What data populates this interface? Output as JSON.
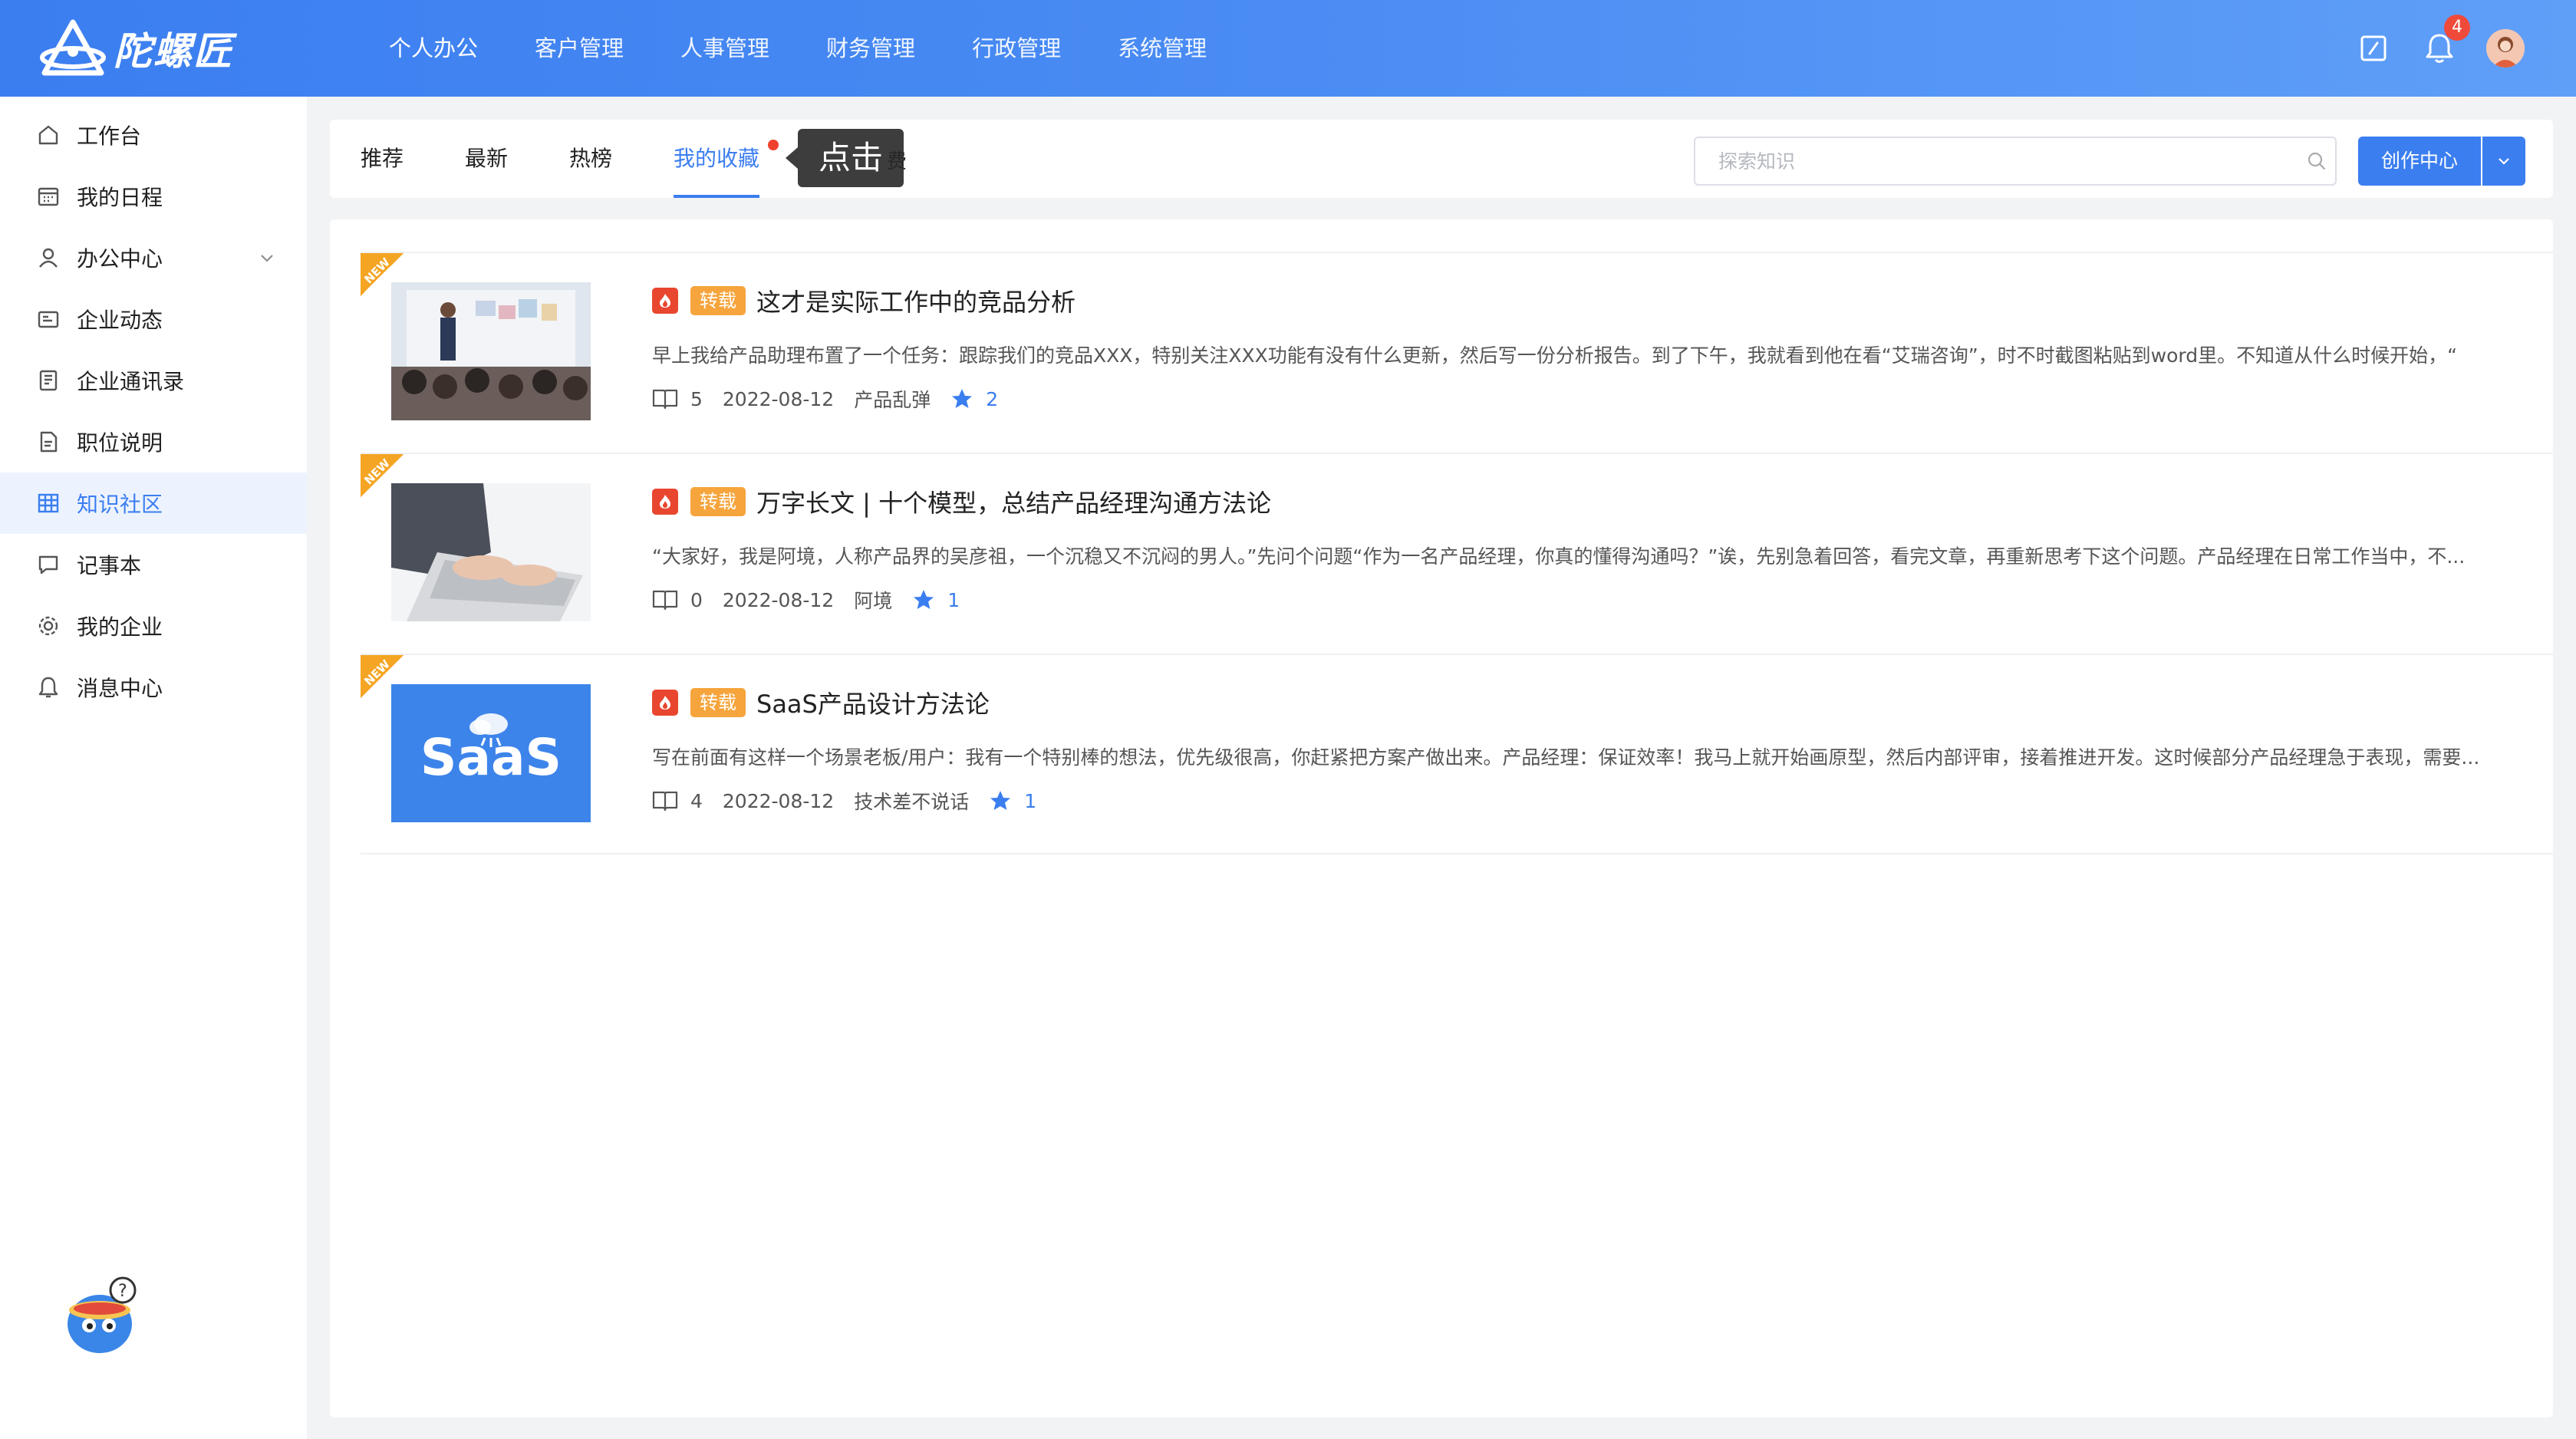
{
  "brand": {
    "name": "陀螺匠"
  },
  "topnav": [
    {
      "label": "个人办公",
      "active": true
    },
    {
      "label": "客户管理"
    },
    {
      "label": "人事管理"
    },
    {
      "label": "财务管理"
    },
    {
      "label": "行政管理"
    },
    {
      "label": "系统管理"
    }
  ],
  "header": {
    "notification_count": "4"
  },
  "sidebar": {
    "items": [
      {
        "label": "工作台",
        "icon": "home-icon"
      },
      {
        "label": "我的日程",
        "icon": "calendar-icon"
      },
      {
        "label": "办公中心",
        "icon": "user-icon",
        "expandable": true
      },
      {
        "label": "企业动态",
        "icon": "news-icon"
      },
      {
        "label": "企业通讯录",
        "icon": "contacts-icon"
      },
      {
        "label": "职位说明",
        "icon": "document-icon"
      },
      {
        "label": "知识社区",
        "icon": "grid-icon",
        "active": true
      },
      {
        "label": "记事本",
        "icon": "chat-icon"
      },
      {
        "label": "我的企业",
        "icon": "gear-icon"
      },
      {
        "label": "消息中心",
        "icon": "bell-icon"
      }
    ]
  },
  "tabs": [
    {
      "label": "推荐"
    },
    {
      "label": "最新"
    },
    {
      "label": "热榜"
    },
    {
      "label": "我的收藏",
      "active": true
    }
  ],
  "tooltip": {
    "text": "点击",
    "tail": "费"
  },
  "search": {
    "placeholder": "探索知识"
  },
  "create": {
    "label": "创作中心"
  },
  "articles": [
    {
      "corner": "NEW",
      "tag": "转载",
      "title": "这才是实际工作中的竞品分析",
      "summary": "早上我给产品助理布置了一个任务：跟踪我们的竞品XXX，特别关注XXX功能有没有什么更新，然后写一份分析报告。到了下午，我就看到他在看“艾瑞咨询”，时不时截图粘贴到word里。不知道从什么时候开始，“",
      "reads": "5",
      "date": "2022-08-12",
      "author": "产品乱弹",
      "stars": "2"
    },
    {
      "corner": "NEW",
      "tag": "转载",
      "title": "万字长文 | 十个模型，总结产品经理沟通方法论",
      "summary": "“大家好，我是阿境，人称产品界的吴彦祖，一个沉稳又不沉闷的男人。”先问个问题“作为一名产品经理，你真的懂得沟通吗？”诶，先别急着回答，看完文章，再重新思考下这个问题。产品经理在日常工作当中，不...",
      "reads": "0",
      "date": "2022-08-12",
      "author": "阿境",
      "stars": "1"
    },
    {
      "corner": "NEW",
      "tag": "转载",
      "title": "SaaS产品设计方法论",
      "summary": "写在前面有这样一个场景老板/用户：我有一个特别棒的想法，优先级很高，你赶紧把方案产做出来。产品经理：保证效率！我马上就开始画原型，然后内部评审，接着推进开发。这时候部分产品经理急于表现，需要...",
      "reads": "4",
      "date": "2022-08-12",
      "author": "技术差不说话",
      "stars": "1",
      "thumb_text": "SaaS"
    }
  ]
}
